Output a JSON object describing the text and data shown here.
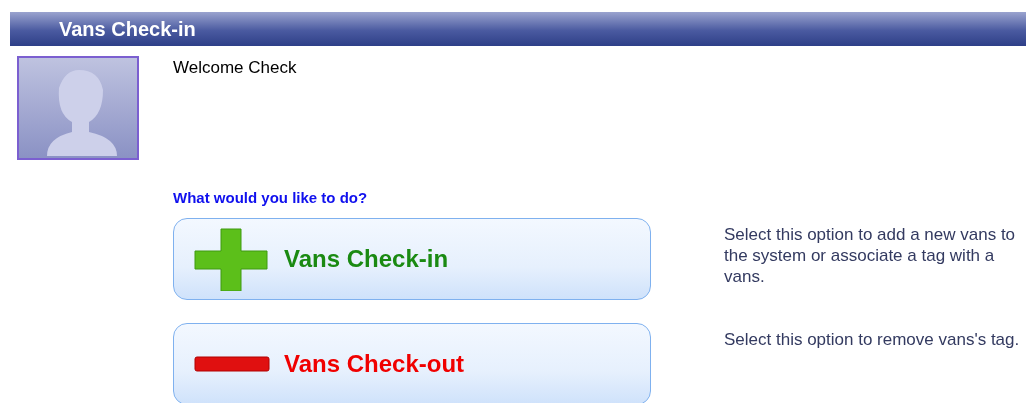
{
  "header": {
    "title": "Vans Check-in"
  },
  "welcome": "Welcome Check",
  "prompt": "What would you like to do?",
  "actions": [
    {
      "kind": "add",
      "label": "Vans Check-in",
      "description": "Select this option to add a new vans to the system or associate a tag with a vans."
    },
    {
      "kind": "remove",
      "label": "Vans Check-out",
      "description": "Select this option to remove vans's tag."
    }
  ]
}
